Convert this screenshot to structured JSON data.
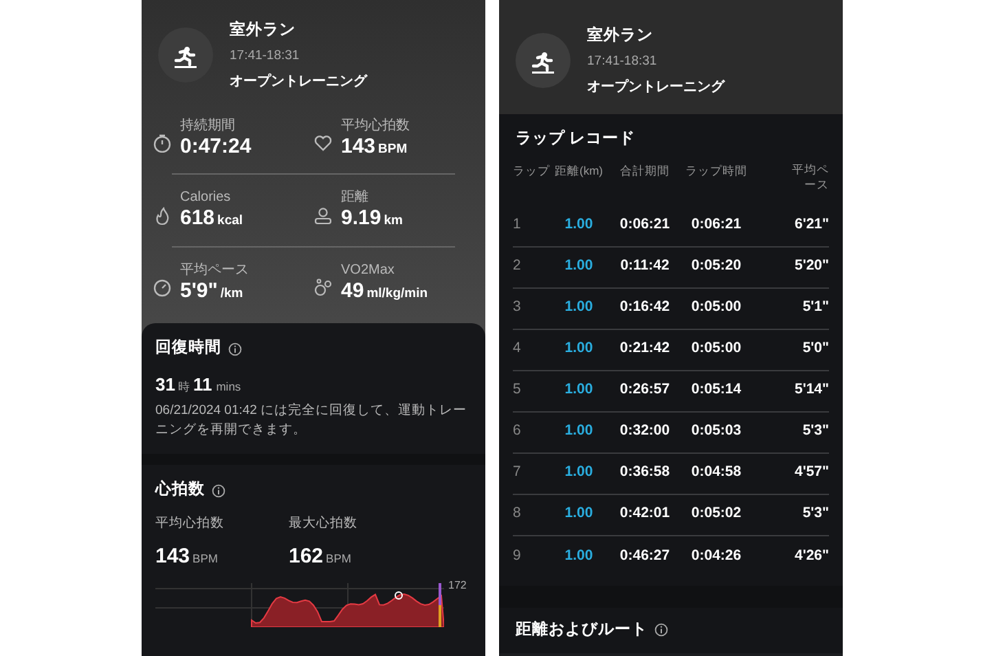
{
  "left_screen": {
    "activity": {
      "title": "室外ラン",
      "time": "17:41-18:31",
      "mode": "オープントレーニング"
    },
    "stats": [
      {
        "kind": "timer",
        "label": "持続期間",
        "value": "0:47:24"
      },
      {
        "kind": "heart",
        "label": "平均心拍数",
        "value": "143",
        "unit": "BPM"
      },
      {
        "kind": "calories",
        "label": "Calories",
        "value": "618",
        "unit": "kcal"
      },
      {
        "kind": "distance",
        "label": "距離",
        "value": "9.19",
        "unit": "km"
      },
      {
        "kind": "pace",
        "label": "平均ペース",
        "value": "5'9\"",
        "unit": "/km"
      },
      {
        "kind": "vo2",
        "label": "VO2Max",
        "value": "49",
        "unit": "ml/kg/min"
      }
    ],
    "recovery": {
      "title": "回復時間",
      "hours": "31",
      "hours_unit": "時",
      "minutes": "11",
      "minutes_unit": "mins",
      "message": "06/21/2024 01:42 には完全に回復して、運動トレーニングを再開できます。"
    },
    "heart_rate": {
      "title": "心拍数",
      "avg_label": "平均心拍数",
      "avg_value": "143",
      "avg_unit": "BPM",
      "max_label": "最大心拍数",
      "max_value": "162",
      "max_unit": "BPM",
      "chart_top_label": "172"
    }
  },
  "right_screen": {
    "activity": {
      "title": "室外ラン",
      "time": "17:41-18:31",
      "mode": "オープントレーニング"
    },
    "laps": {
      "title": "ラップ レコード",
      "columns": [
        "ラップ",
        "距離(km)",
        "合計期間",
        "ラップ時間",
        "平均ペース"
      ],
      "rows": [
        [
          "1",
          "1.00",
          "0:06:21",
          "0:06:21",
          "6'21\""
        ],
        [
          "2",
          "1.00",
          "0:11:42",
          "0:05:20",
          "5'20\""
        ],
        [
          "3",
          "1.00",
          "0:16:42",
          "0:05:00",
          "5'1\""
        ],
        [
          "4",
          "1.00",
          "0:21:42",
          "0:05:00",
          "5'0\""
        ],
        [
          "5",
          "1.00",
          "0:26:57",
          "0:05:14",
          "5'14\""
        ],
        [
          "6",
          "1.00",
          "0:32:00",
          "0:05:03",
          "5'3\""
        ],
        [
          "7",
          "1.00",
          "0:36:58",
          "0:04:58",
          "4'57\""
        ],
        [
          "8",
          "1.00",
          "0:42:01",
          "0:05:02",
          "5'3\""
        ],
        [
          "9",
          "1.00",
          "0:46:27",
          "0:04:26",
          "4'26\""
        ]
      ]
    },
    "route": {
      "title": "距離およびルート"
    }
  }
}
